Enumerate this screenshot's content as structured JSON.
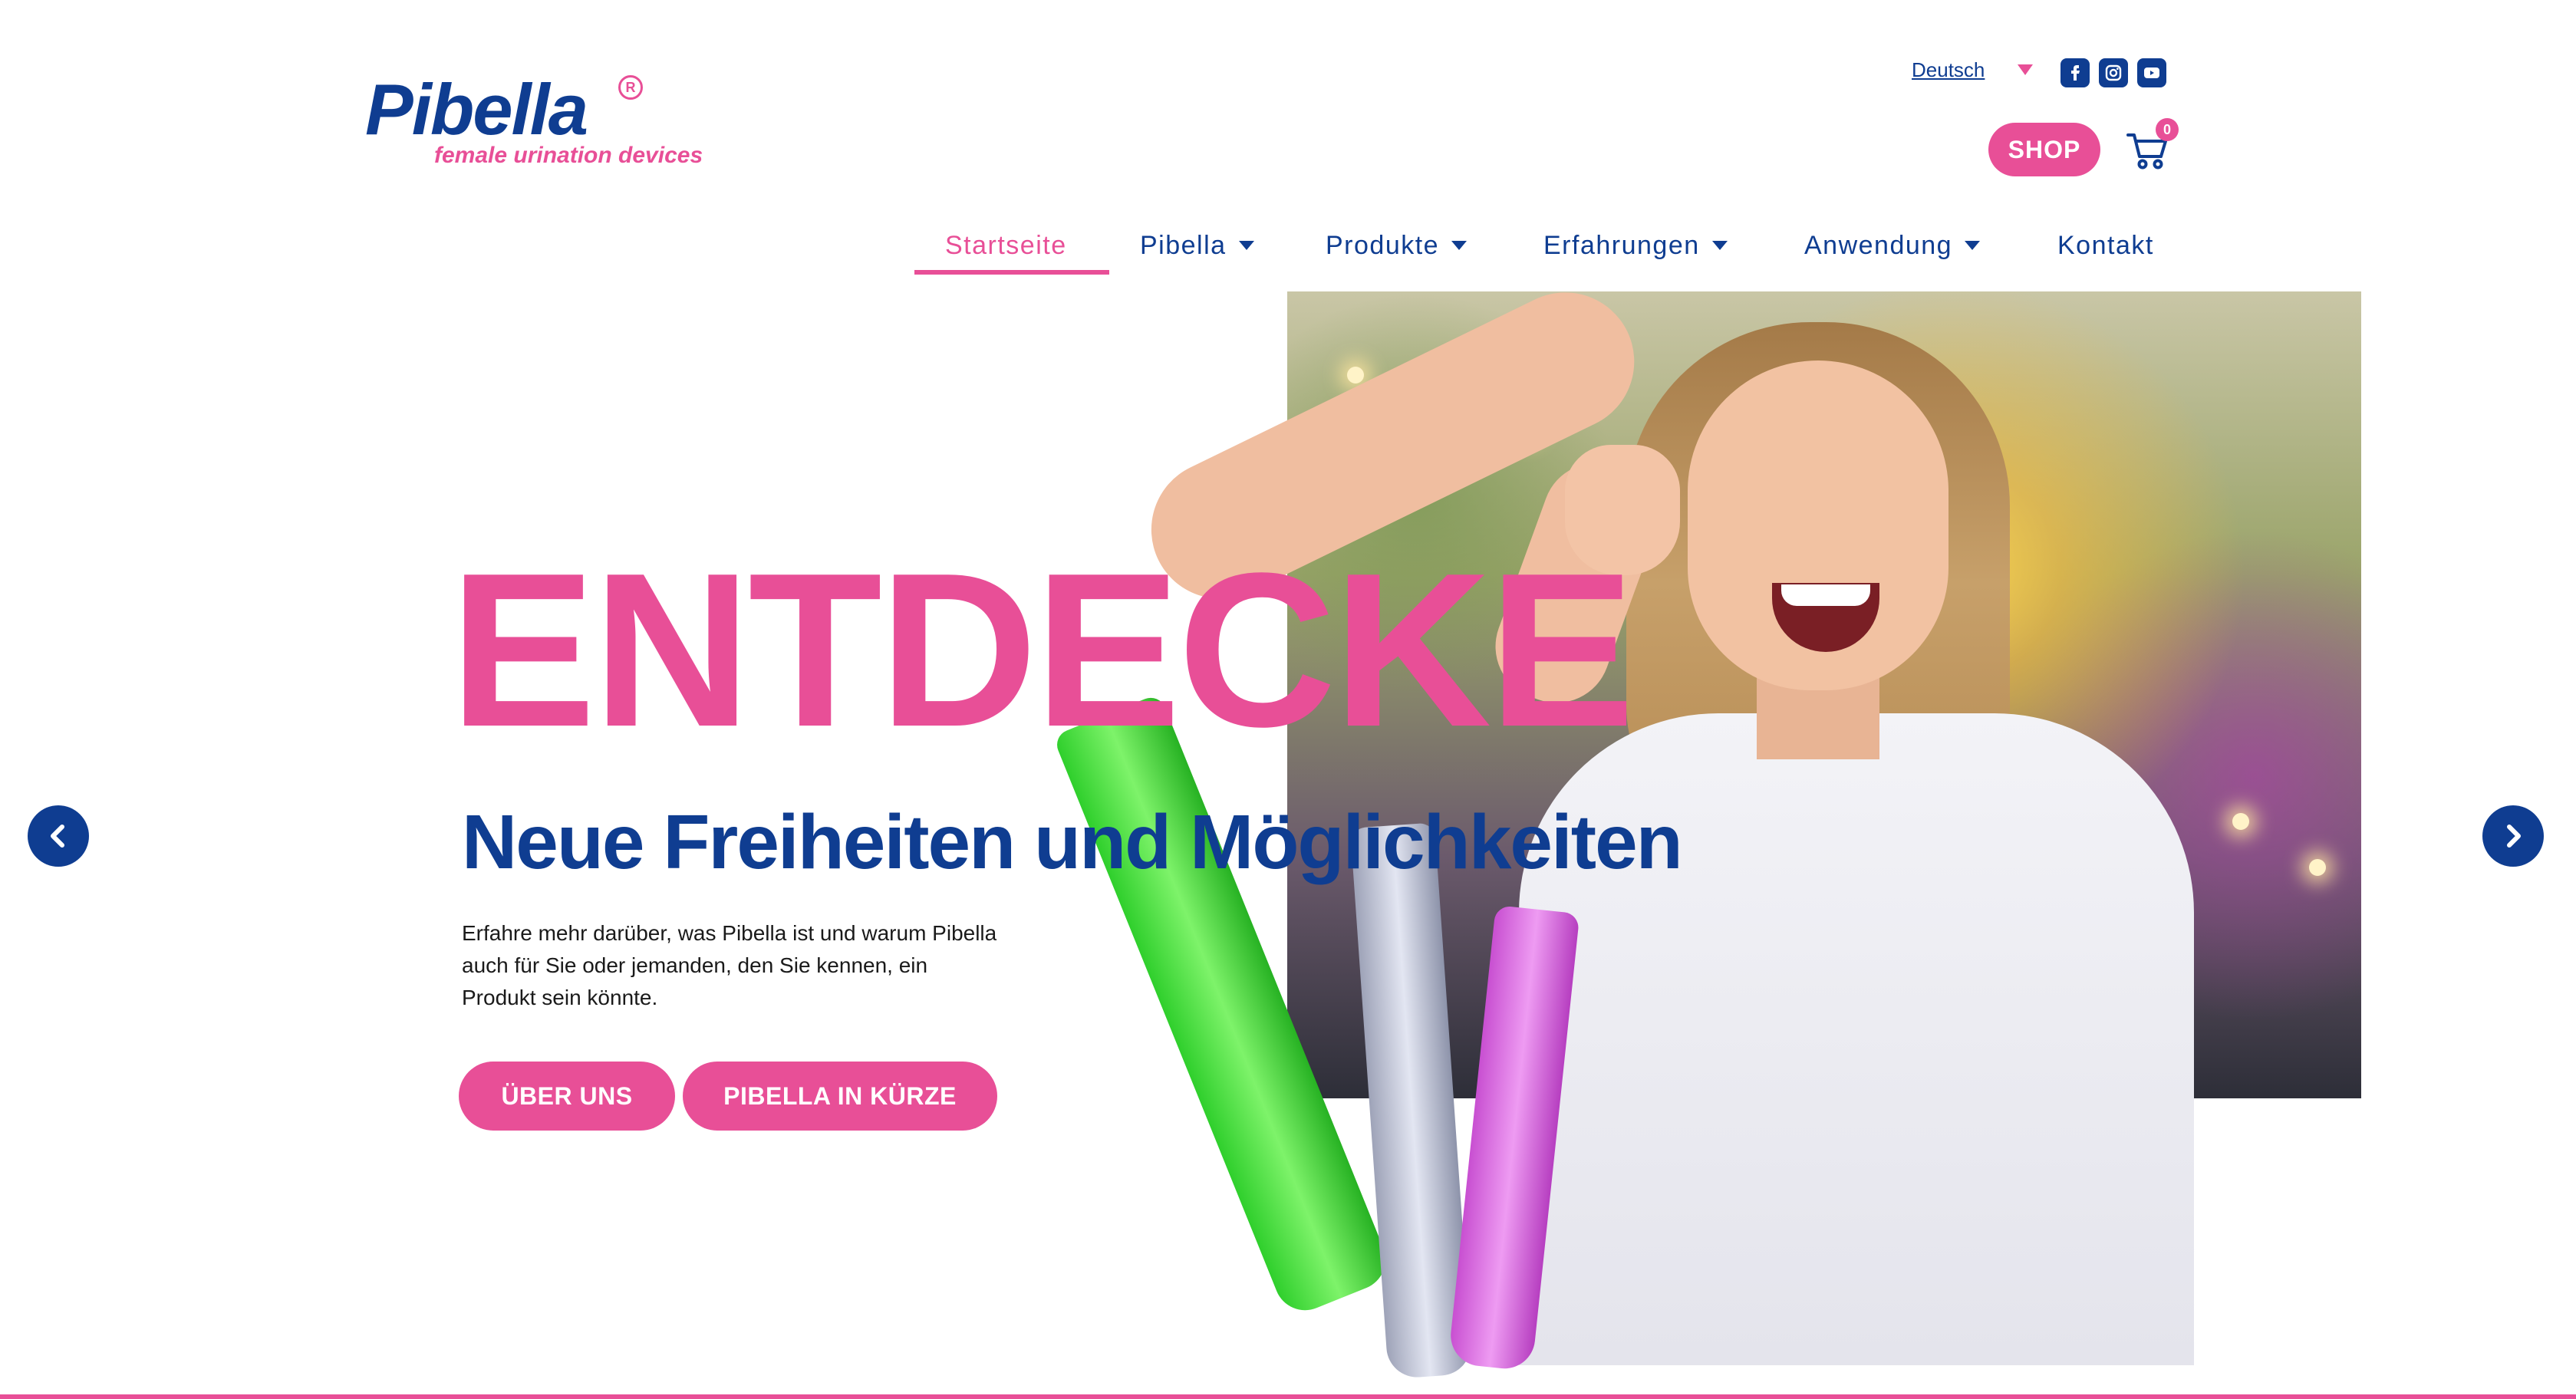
{
  "brand": {
    "name": "Pibella",
    "registered_mark": "R",
    "tagline": "female urination devices",
    "colors": {
      "pink": "#e84f97",
      "navy": "#0f3d91"
    }
  },
  "header": {
    "language": "Deutsch",
    "social": [
      "facebook-icon",
      "instagram-icon",
      "youtube-icon"
    ],
    "shop_label": "SHOP",
    "cart_count": "0"
  },
  "nav": {
    "items": [
      {
        "label": "Startseite",
        "active": true,
        "dropdown": false
      },
      {
        "label": "Pibella",
        "active": false,
        "dropdown": true
      },
      {
        "label": "Produkte",
        "active": false,
        "dropdown": true
      },
      {
        "label": "Erfahrungen",
        "active": false,
        "dropdown": true
      },
      {
        "label": "Anwendung",
        "active": false,
        "dropdown": true
      },
      {
        "label": "Kontakt",
        "active": false,
        "dropdown": false
      }
    ]
  },
  "hero": {
    "title": "ENTDECKE",
    "subtitle": "Neue Freiheiten und Möglichkeiten",
    "text": "Erfahre mehr darüber, was Pibella ist und warum Pibella auch für Sie oder jemanden, den Sie kennen, ein Produkt sein könnte.",
    "buttons": [
      "ÜBER UNS",
      "PIBELLA IN KÜRZE"
    ]
  }
}
